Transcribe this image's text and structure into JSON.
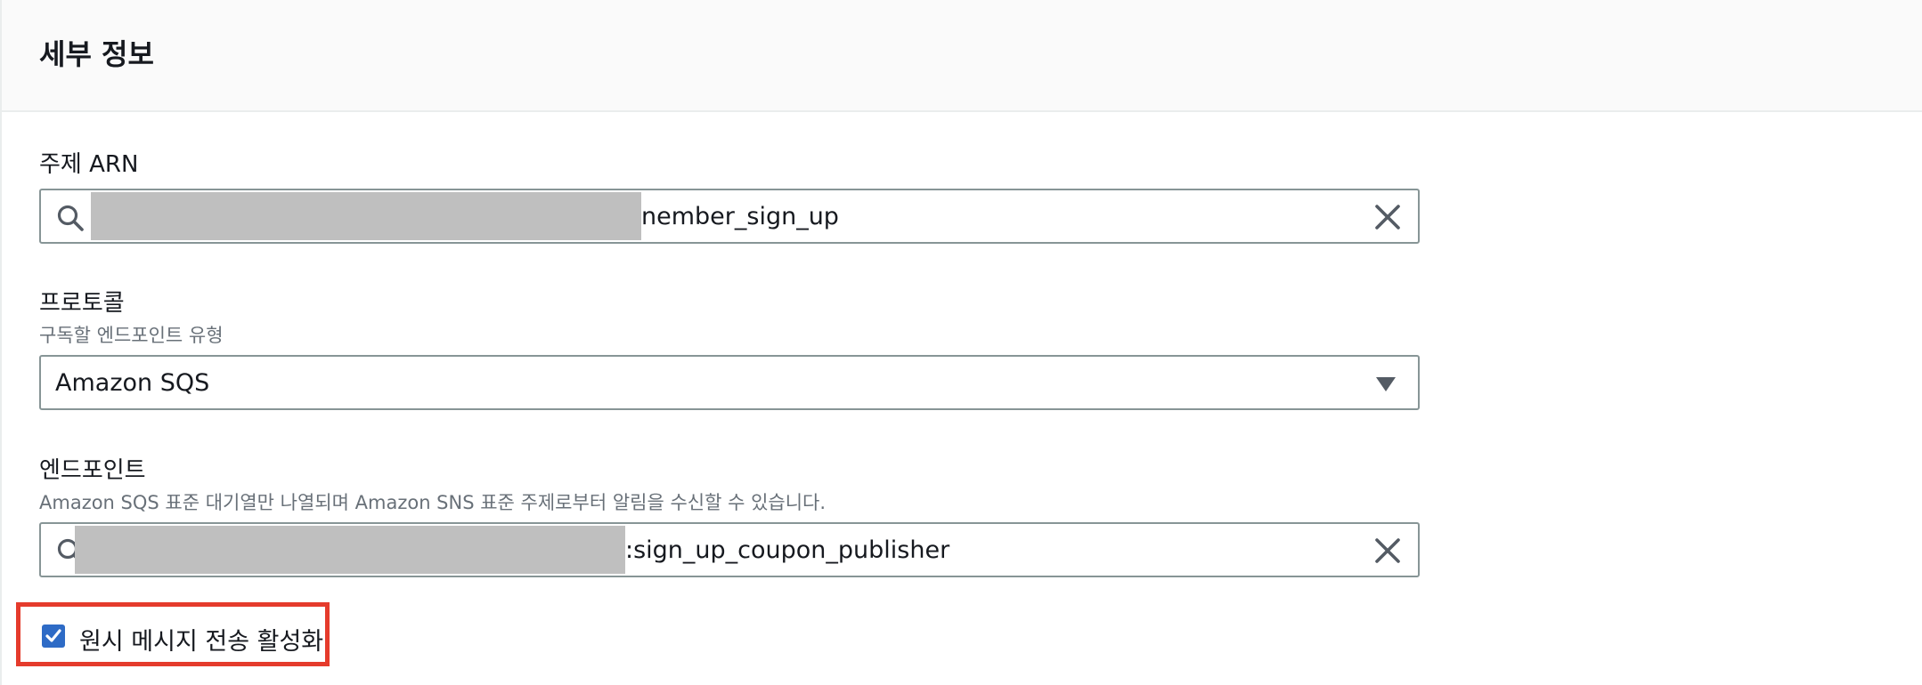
{
  "panel": {
    "title": "세부 정보"
  },
  "topic_arn": {
    "label": "주제 ARN",
    "value_visible": "nember_sign_up",
    "icon": "search-icon",
    "clear_icon": "close-icon"
  },
  "protocol": {
    "label": "프로토콜",
    "description": "구독할 엔드포인트 유형",
    "selected": "Amazon SQS",
    "icon": "caret-down-icon"
  },
  "endpoint": {
    "label": "엔드포인트",
    "description": "Amazon SQS 표준 대기열만 나열되며 Amazon SNS 표준 주제로부터 알림을 수신할 수 있습니다.",
    "value_visible": ":sign_up_coupon_publisher",
    "icon": "search-icon",
    "clear_icon": "close-icon"
  },
  "raw_message_delivery": {
    "label": "원시 메시지 전송 활성화",
    "checked": true
  },
  "colors": {
    "accent": "#2e6bc6",
    "highlight_border": "#e53b2c",
    "redaction": "#bfbfbf",
    "input_border": "#879596"
  }
}
